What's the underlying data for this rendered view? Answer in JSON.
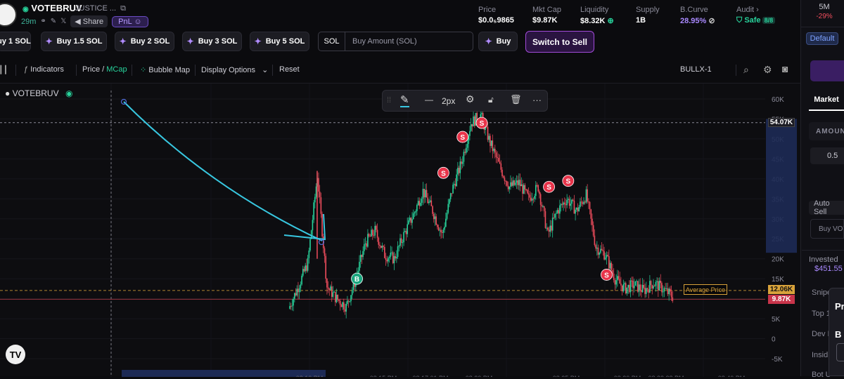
{
  "token": {
    "ticker": "VOTEBRUV",
    "name": "JUSTICE ...",
    "age": "29m",
    "share_label": "Share",
    "pnl_label": "PnL"
  },
  "stats": [
    {
      "label": "Price",
      "value": "$0.0₅9865"
    },
    {
      "label": "Mkt Cap",
      "value": "$9.87K"
    },
    {
      "label": "Liquidity",
      "value": "$8.32K"
    },
    {
      "label": "Supply",
      "value": "1B"
    },
    {
      "label": "B.Curve",
      "value": "28.95%"
    },
    {
      "label": "Audit",
      "value": "Safe",
      "badge": "8/8"
    }
  ],
  "right_panel": {
    "timeframe": "5M",
    "change": "-29%",
    "default_label": "Default",
    "market_tab": "Market",
    "amount_label": "AMOUN",
    "amount_value": "0.5",
    "auto_sell": "Auto Sell",
    "buy_vote": "Buy VOT",
    "invested_label": "Invested",
    "invested_value": "$451.55",
    "snipe_label": "Snipe",
    "top_label": "Top 1",
    "dev_label": "Dev H",
    "insiders_label": "Insid",
    "bot_label": "Bot U",
    "popup_pr": "Pr",
    "popup_b": "B"
  },
  "buy_buttons": [
    "uy 1 SOL",
    "Buy 1.5 SOL",
    "Buy 2 SOL",
    "Buy 3 SOL",
    "Buy 5 SOL"
  ],
  "amount_input": {
    "prefix": "SOL",
    "placeholder": "Buy Amount (SOL)"
  },
  "buy_label": "Buy",
  "switch_label": "Switch to Sell",
  "toolbar": {
    "indicators": "Indicators",
    "price": "Price",
    "slash": "/",
    "mcap": "MCap",
    "bubble_map": "Bubble Map",
    "display_options": "Display Options",
    "reset": "Reset",
    "source": "BULLX-1"
  },
  "chart_data": {
    "type": "candlestick",
    "title": "VOTEBRUV",
    "unit": "market cap (USD)",
    "y_ticks": [
      "60K",
      "55K",
      "50K",
      "45K",
      "40K",
      "35K",
      "30K",
      "25K",
      "20K",
      "15K",
      "10K",
      "5K",
      "0",
      "-5K"
    ],
    "ylim": [
      -5000,
      60000
    ],
    "x_ticks": [
      "08:10 PM",
      "08:15 PM",
      "08:17:01 PM",
      "08:20 PM",
      "08:25 PM",
      "08:30 PM",
      "08:33:28 PM",
      "08:40 PM"
    ],
    "price_path": [
      [
        0,
        7500
      ],
      [
        1,
        13000
      ],
      [
        2,
        19000
      ],
      [
        3,
        41000
      ],
      [
        4,
        13000
      ],
      [
        5,
        10000
      ],
      [
        6,
        8000
      ],
      [
        7,
        15000
      ],
      [
        8,
        24000
      ],
      [
        9,
        27000
      ],
      [
        10,
        21000
      ],
      [
        11,
        20000
      ],
      [
        12,
        26000
      ],
      [
        13,
        31000
      ],
      [
        14,
        37000
      ],
      [
        15,
        32000
      ],
      [
        16,
        26000
      ],
      [
        17,
        37000
      ],
      [
        18,
        44000
      ],
      [
        19,
        54000
      ],
      [
        20,
        56000
      ],
      [
        21,
        49000
      ],
      [
        22,
        43000
      ],
      [
        23,
        38000
      ],
      [
        24,
        39000
      ],
      [
        25,
        35000
      ],
      [
        26,
        38000
      ],
      [
        27,
        26000
      ],
      [
        28,
        32000
      ],
      [
        29,
        35000
      ],
      [
        30,
        32000
      ],
      [
        31,
        36000
      ],
      [
        32,
        23000
      ],
      [
        33,
        21000
      ],
      [
        34,
        15000
      ],
      [
        35,
        12500
      ],
      [
        36,
        13500
      ],
      [
        37,
        12000
      ],
      [
        38,
        14000
      ],
      [
        39,
        12500
      ],
      [
        40,
        10500
      ]
    ],
    "price_labels": [
      {
        "text": "54.07K",
        "value": 54070,
        "color": "#ffffff"
      },
      {
        "text": "12.06K",
        "value": 12060,
        "color": "#d8a23a"
      },
      {
        "text": "9.87K",
        "value": 9870,
        "color": "#f04d5d"
      }
    ],
    "average_price_label": "Average Price",
    "trade_markers": [
      {
        "type": "B",
        "x_index": 7,
        "value": 15000
      },
      {
        "type": "S",
        "x_index": 16,
        "value": 41500
      },
      {
        "type": "S",
        "x_index": 18,
        "value": 50500
      },
      {
        "type": "S",
        "x_index": 20,
        "value": 54000
      },
      {
        "type": "S",
        "x_index": 27,
        "value": 38000
      },
      {
        "type": "S",
        "x_index": 29,
        "value": 39500
      },
      {
        "type": "S",
        "x_index": 33,
        "value": 16000
      }
    ]
  },
  "drawing_toolbar": {
    "stroke_label": "2px"
  },
  "colors": {
    "up": "#28d39c",
    "down": "#f04d5d",
    "accent": "#a24bd8",
    "trendline": "#38c7e0",
    "average": "#d8a23a"
  },
  "icons": [
    "twitter-x-icon",
    "copy-icon",
    "link-icon",
    "gear-icon",
    "lock-icon",
    "trash-icon",
    "camera-icon",
    "search-icon",
    "pencil-icon"
  ]
}
